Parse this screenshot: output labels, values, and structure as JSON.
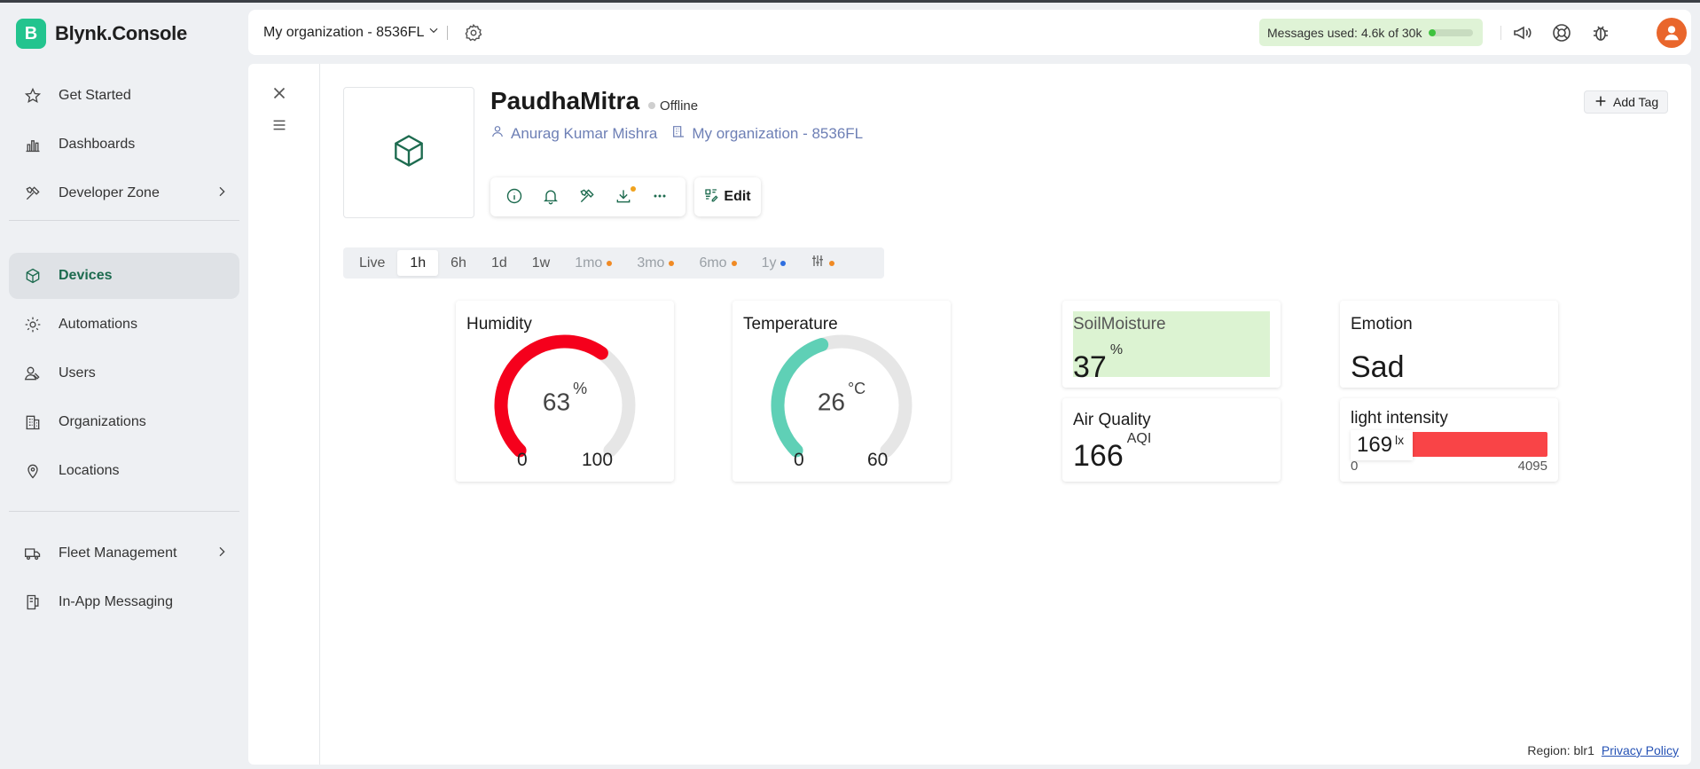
{
  "brand": {
    "logo_letter": "B",
    "name": "Blynk.Console",
    "color": "#23c48e"
  },
  "sidebar": {
    "items": [
      {
        "label": "Get Started",
        "icon": "star-icon"
      },
      {
        "label": "Dashboards",
        "icon": "bar-chart-icon"
      },
      {
        "label": "Developer Zone",
        "icon": "tools-icon",
        "has_submenu": true
      },
      {
        "label": "Devices",
        "icon": "cube-icon",
        "active": true
      },
      {
        "label": "Automations",
        "icon": "automation-icon"
      },
      {
        "label": "Users",
        "icon": "users-icon"
      },
      {
        "label": "Organizations",
        "icon": "building-icon"
      },
      {
        "label": "Locations",
        "icon": "map-pin-icon"
      },
      {
        "label": "Fleet Management",
        "icon": "truck-icon",
        "has_submenu": true
      },
      {
        "label": "In-App Messaging",
        "icon": "message-icon"
      }
    ]
  },
  "topbar": {
    "org_selector": "My organization - 8536FL",
    "messages_label": "Messages used:",
    "messages_value": "4.6k of 30k",
    "messages_progress": 0.15
  },
  "device": {
    "name": "PaudhaMitra",
    "status": "Offline",
    "owner": "Anurag Kumar Mishra",
    "organization": "My organization - 8536FL",
    "edit_label": "Edit",
    "add_tag_label": "Add Tag"
  },
  "time_tabs": [
    {
      "label": "Live"
    },
    {
      "label": "1h",
      "selected": true
    },
    {
      "label": "6h"
    },
    {
      "label": "1d"
    },
    {
      "label": "1w"
    },
    {
      "label": "1mo",
      "dot": "#f08a24"
    },
    {
      "label": "3mo",
      "dot": "#f08a24"
    },
    {
      "label": "6mo",
      "dot": "#f08a24"
    },
    {
      "label": "1y",
      "dot": "#2f6fe0"
    },
    {
      "label": "",
      "icon": "sliders-icon",
      "dot": "#f08a24"
    }
  ],
  "widgets": {
    "humidity": {
      "title": "Humidity",
      "value": "63",
      "unit": "%",
      "min": "0",
      "max": "100",
      "fraction": 0.63,
      "color": "#f5001c"
    },
    "temperature": {
      "title": "Temperature",
      "value": "26",
      "unit": "°C",
      "min": "0",
      "max": "60",
      "fraction": 0.433,
      "color": "#5fd0b6"
    },
    "soil_moisture": {
      "title": "SoilMoisture",
      "value": "37",
      "unit": "%",
      "background": "#dcf3d2"
    },
    "emotion": {
      "title": "Emotion",
      "value": "Sad"
    },
    "air_quality": {
      "title": "Air Quality",
      "value": "166",
      "unit": "AQI"
    },
    "light_intensity": {
      "title": "light intensity",
      "value": "169",
      "unit": "lx",
      "min": "0",
      "max": "4095",
      "color": "#f94447"
    }
  },
  "footer": {
    "region": "Region: blr1",
    "privacy": "Privacy Policy"
  }
}
